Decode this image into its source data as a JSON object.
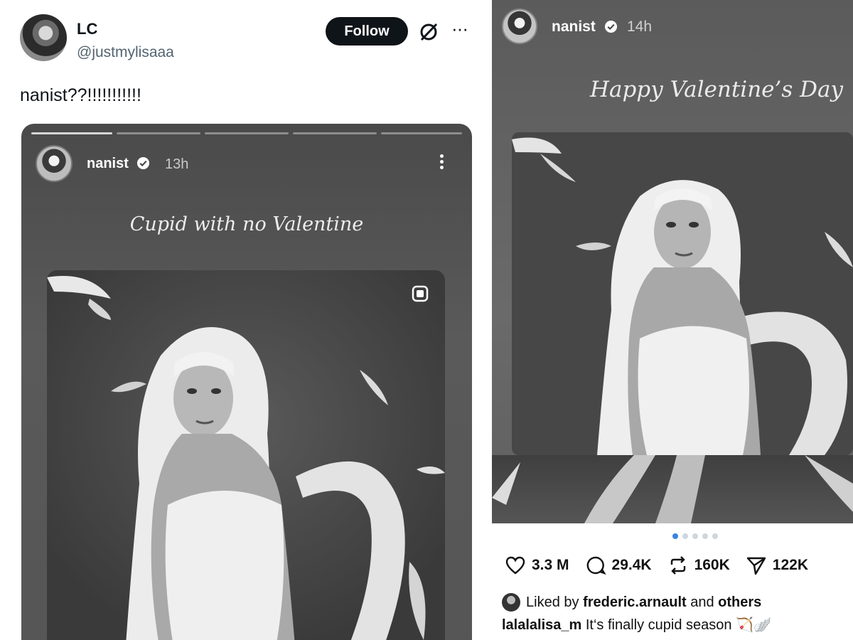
{
  "tweet": {
    "display_name": "LC",
    "handle": "@justmylisaaa",
    "follow_label": "Follow",
    "more_label": "···",
    "text": "nanist??!!!!!!!!!!!"
  },
  "story": {
    "username": "nanist",
    "time": "13h",
    "caption": "Cupid with no Valentine",
    "progress_segments": 5,
    "active_segment": 1
  },
  "threads_post": {
    "username": "nanist",
    "time": "14h",
    "caption": "Happy Valentine’s Day",
    "carousel_dots": 5,
    "active_dot": 1,
    "likes": "3.3 M",
    "comments": "29.4K",
    "reposts": "160K",
    "shares": "122K",
    "liked_by_prefix": "Liked by",
    "liked_by_user": "frederic.arnault",
    "liked_by_and": "and",
    "liked_by_others": "others",
    "comment_user": "lalalalisa_m",
    "comment_text": "It‘s finally cupid season 🏹🪽"
  },
  "colors": {
    "follow_bg": "#0f1419",
    "handle_gray": "#536471",
    "dot_active": "#3d82e0",
    "dot_inactive": "#cfd6dc"
  }
}
